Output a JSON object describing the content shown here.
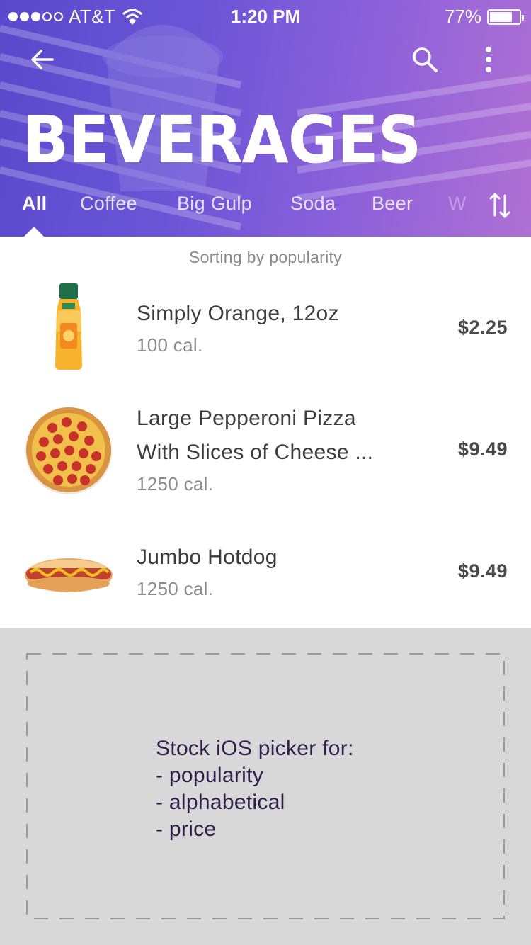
{
  "status_bar": {
    "carrier": "AT&T",
    "time": "1:20 PM",
    "battery_percent": "77%",
    "battery_level": 0.77,
    "signal_bars_filled": 3,
    "signal_bars_total": 5
  },
  "header": {
    "title": "BEVERAGES",
    "icons": {
      "back": "arrow-left-icon",
      "search": "search-icon",
      "more": "more-vertical-icon",
      "sort": "sort-arrows-icon"
    },
    "gradient_colors": [
      "#5a49cc",
      "#8a60da",
      "#b070d4"
    ]
  },
  "tabs": [
    {
      "label": "All",
      "active": true
    },
    {
      "label": "Coffee",
      "active": false
    },
    {
      "label": "Big Gulp",
      "active": false
    },
    {
      "label": "Soda",
      "active": false
    },
    {
      "label": "Beer",
      "active": false
    },
    {
      "label": "W",
      "active": false
    }
  ],
  "list": {
    "sort_caption": "Sorting by popularity",
    "items": [
      {
        "name_lines": [
          "Simply Orange, 12oz"
        ],
        "calories": "100 cal.",
        "price": "$2.25",
        "image": "orange-juice-bottle"
      },
      {
        "name_lines": [
          "Large Pepperoni Pizza",
          "With Slices of Cheese ..."
        ],
        "calories": "1250 cal.",
        "price": "$9.49",
        "image": "pepperoni-pizza"
      },
      {
        "name_lines": [
          "Jumbo Hotdog"
        ],
        "calories": "1250 cal.",
        "price": "$9.49",
        "image": "hotdog"
      }
    ]
  },
  "picker_placeholder": {
    "lines": [
      "Stock iOS picker for:",
      "- popularity",
      "- alphabetical",
      "- price"
    ]
  }
}
